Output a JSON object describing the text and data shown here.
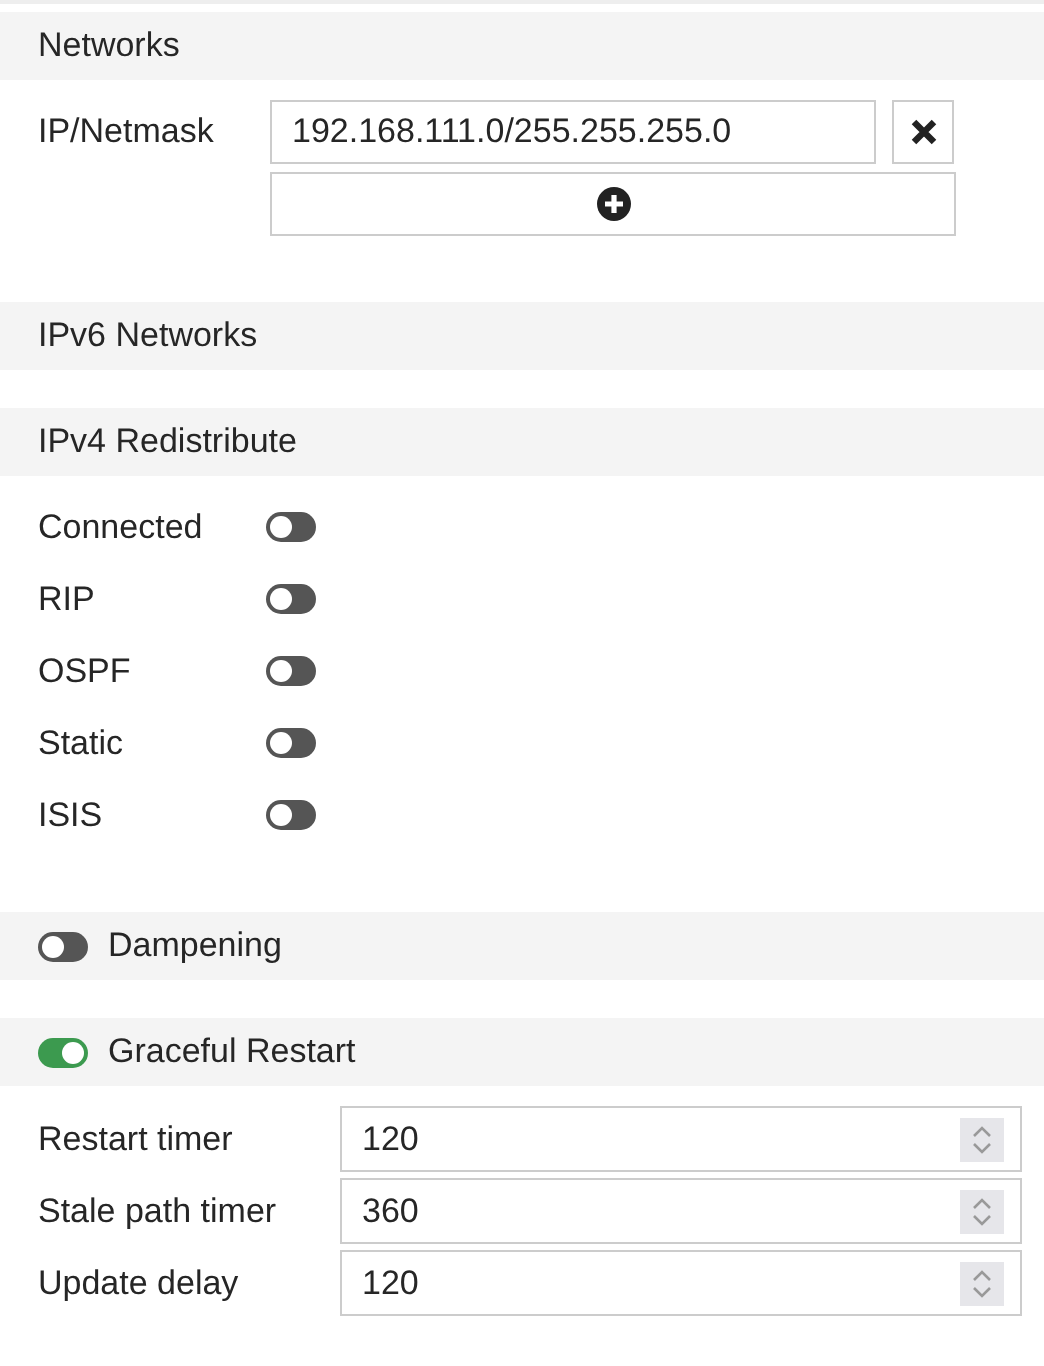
{
  "networks": {
    "title": "Networks",
    "label": "IP/Netmask",
    "entries": [
      {
        "value": "192.168.111.0/255.255.255.0"
      }
    ]
  },
  "ipv6": {
    "title": "IPv6 Networks"
  },
  "redistribute": {
    "title": "IPv4 Redistribute",
    "items": [
      {
        "label": "Connected",
        "on": false
      },
      {
        "label": "RIP",
        "on": false
      },
      {
        "label": "OSPF",
        "on": false
      },
      {
        "label": "Static",
        "on": false
      },
      {
        "label": "ISIS",
        "on": false
      }
    ]
  },
  "dampening": {
    "title": "Dampening",
    "on": false
  },
  "graceful_restart": {
    "title": "Graceful Restart",
    "on": true,
    "fields": [
      {
        "label": "Restart timer",
        "value": "120"
      },
      {
        "label": "Stale path timer",
        "value": "360"
      },
      {
        "label": "Update delay",
        "value": "120"
      }
    ]
  }
}
